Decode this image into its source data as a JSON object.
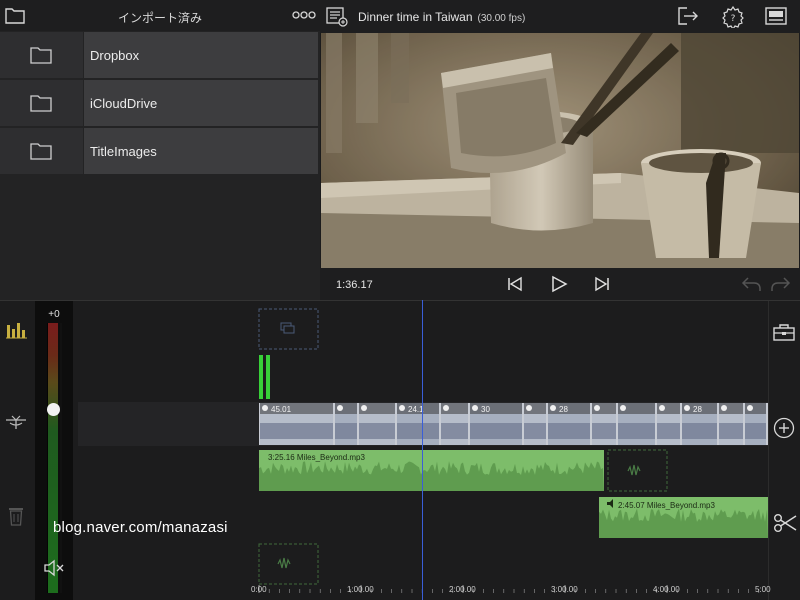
{
  "browser": {
    "title": "インポート済み",
    "folders": [
      "Dropbox",
      "iCloudDrive",
      "TitleImages"
    ]
  },
  "preview": {
    "title": "Dinner time in Taiwan",
    "fps": "(30.00 fps)",
    "timecode": "1:36.17"
  },
  "timeline": {
    "volume_label": "+0",
    "clip_thumbs": [
      {
        "label": "45.01"
      },
      {
        "label": ""
      },
      {
        "label": ""
      },
      {
        "label": "24.1"
      },
      {
        "label": ""
      },
      {
        "label": "30"
      },
      {
        "label": ""
      },
      {
        "label": "28"
      },
      {
        "label": ""
      },
      {
        "label": ""
      },
      {
        "label": ""
      },
      {
        "label": "28"
      }
    ],
    "audio1_label": "3:25.16 Miles_Beyond.mp3",
    "audio2_label": "2:45.07 Miles_Beyond.mp3",
    "ruler": [
      "0:00",
      "1:00.00",
      "2:00.00",
      "3:00.00",
      "4:00.00",
      "5:00"
    ]
  },
  "watermark": "blog.naver.com/manazasi",
  "colors": {
    "audio_green": "#7dbd6a",
    "playhead": "#3a5ed8",
    "meter_red": "#7a1c1c",
    "meter_green": "#2d8a2d"
  },
  "icons": {
    "header": [
      "folder-icon",
      "more-icon"
    ],
    "preview": [
      "project-settings-icon",
      "export-icon",
      "gear-icon",
      "layout-icon"
    ],
    "transport": [
      "skip-back-icon",
      "play-icon",
      "skip-forward-icon",
      "undo-icon",
      "redo-icon"
    ],
    "timeline": [
      "audio-meter-icon",
      "track-lift-icon",
      "trash-icon",
      "mute-icon",
      "toolbox-icon",
      "add-icon",
      "scissors-icon"
    ]
  }
}
